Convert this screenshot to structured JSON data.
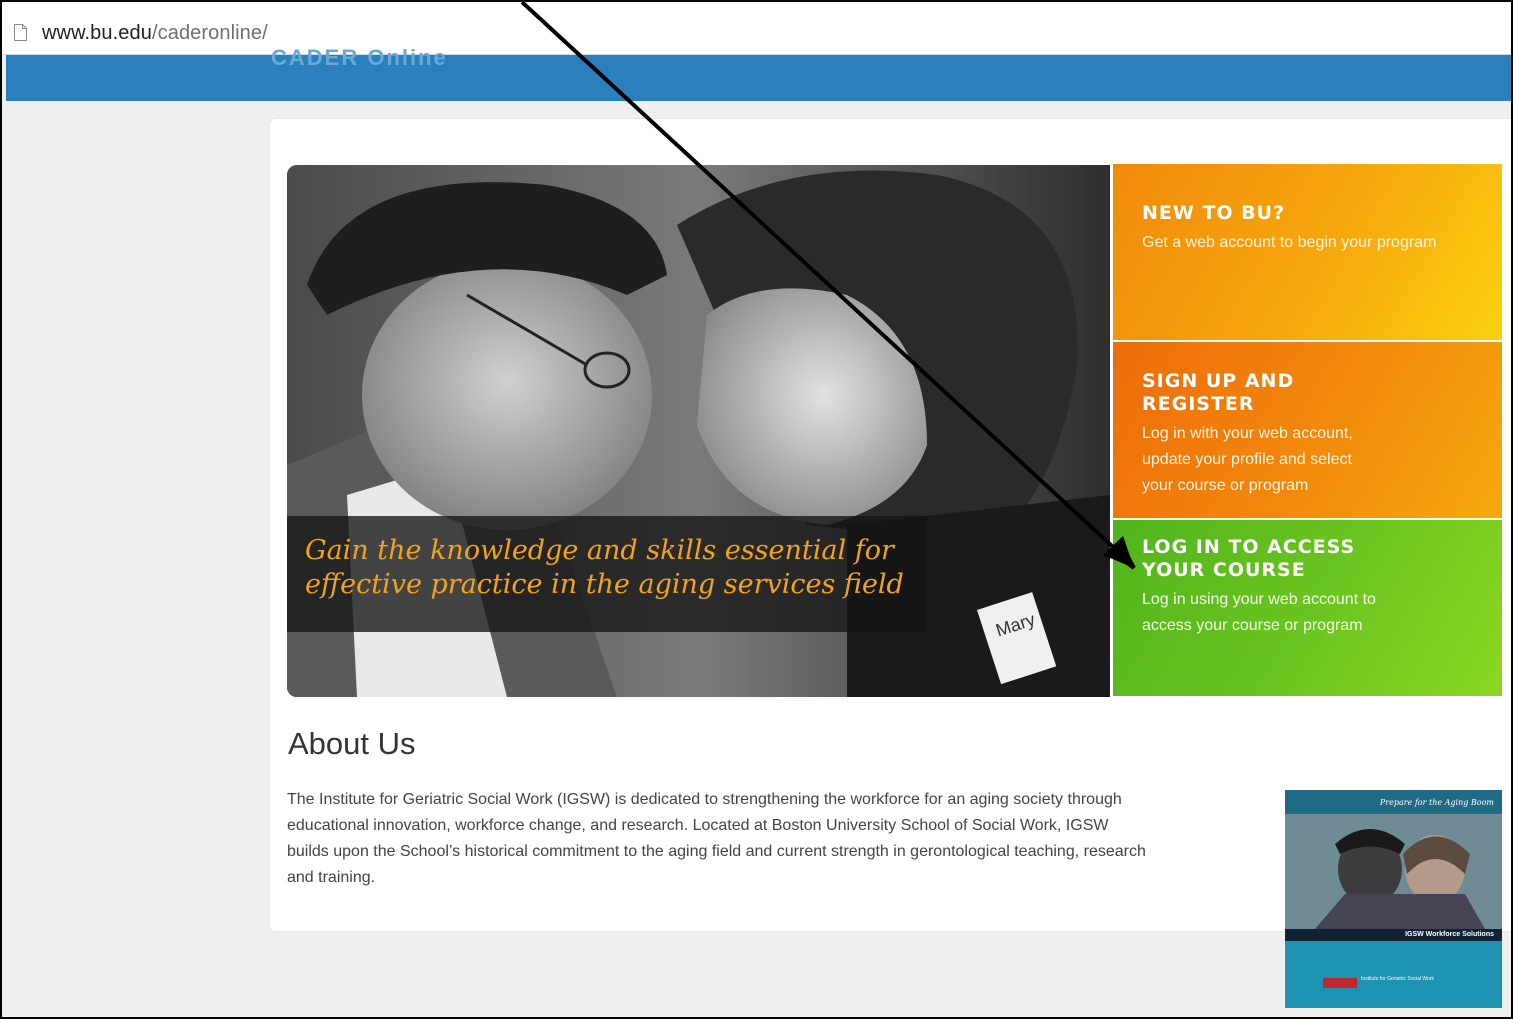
{
  "browser": {
    "url_domain": "www.bu.edu",
    "url_path": "/caderonline/"
  },
  "banner": {
    "partial_text": "CADER Online"
  },
  "hero": {
    "tagline": "Gain the knowledge and skills essential for effective practice in the aging services field",
    "name_tag": "Mary"
  },
  "tiles": [
    {
      "title": "NEW TO BU?",
      "description": "Get a web account to begin your program",
      "color": "#f7a80d"
    },
    {
      "title": "SIGN UP AND REGISTER",
      "description": "Log in with your web account, update your profile and select your course or program",
      "color": "#f28a0c"
    },
    {
      "title": "LOG IN TO ACCESS YOUR COURSE",
      "description": "Log in using your web account to access your course or program",
      "color": "#6cc51f"
    }
  ],
  "about": {
    "heading": "About Us",
    "body": "The Institute for Geriatric Social Work (IGSW) is dedicated to strengthening the workforce for an aging society through educational innovation, workforce change, and research. Located at Boston University School of Social Work, IGSW builds upon the School’s historical commitment to the aging field and current strength in gerontological teaching, research and training."
  },
  "brochure": {
    "tagline": "Prepare for the Aging Boom",
    "band_text": "IGSW Workforce Solutions",
    "org_text": "Institute for Geriatric Social Work"
  },
  "colors": {
    "banner": "#2a80bd",
    "tagline": "#f2a31b",
    "arrow": "#000000"
  }
}
